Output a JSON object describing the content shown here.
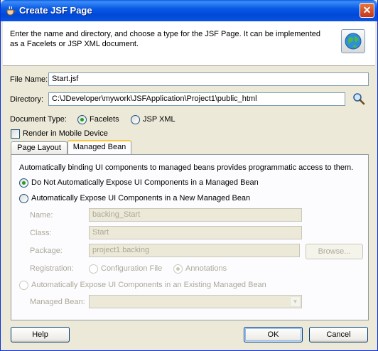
{
  "window": {
    "title": "Create JSF Page",
    "close_glyph": "✕"
  },
  "header": {
    "description": "Enter the name and directory, and choose a type for the JSF Page. It can be implemented as a Facelets or JSP XML document.",
    "icon": "globe-icon"
  },
  "file_name": {
    "label": "File Name:",
    "value": "Start.jsf"
  },
  "directory": {
    "label": "Directory:",
    "value": "C:\\JDeveloper\\mywork\\JSFApplication\\Project1\\public_html",
    "browse_icon": "magnifier-icon"
  },
  "document_type": {
    "label": "Document Type:",
    "options": [
      {
        "label": "Facelets",
        "selected": true
      },
      {
        "label": "JSP XML",
        "selected": false
      }
    ]
  },
  "render_mobile": {
    "label": "Render in Mobile Device",
    "checked": false
  },
  "tabs": [
    {
      "label": "Page Layout",
      "active": false
    },
    {
      "label": "Managed Bean",
      "active": true
    }
  ],
  "managed_bean": {
    "intro": "Automatically binding UI components to managed beans provides programmatic access to them.",
    "option_none": "Do Not Automatically Expose UI Components in a Managed Bean",
    "option_new": "Automatically Expose UI Components in a New Managed Bean",
    "name_label": "Name:",
    "name_value": "backing_Start",
    "class_label": "Class:",
    "class_value": "Start",
    "package_label": "Package:",
    "package_value": "project1.backing",
    "browse_label": "Browse...",
    "registration_label": "Registration:",
    "reg_config": "Configuration File",
    "reg_annotations": "Annotations",
    "option_existing": "Automatically Expose UI Components in an Existing Managed Bean",
    "managed_bean_label": "Managed Bean:",
    "managed_bean_value": ""
  },
  "buttons": {
    "help": "Help",
    "ok": "OK",
    "cancel": "Cancel"
  },
  "colors": {
    "title_bar": "#0a5ae6",
    "dialog_bg": "#ece9d8",
    "selected_radio": "#21a121"
  }
}
